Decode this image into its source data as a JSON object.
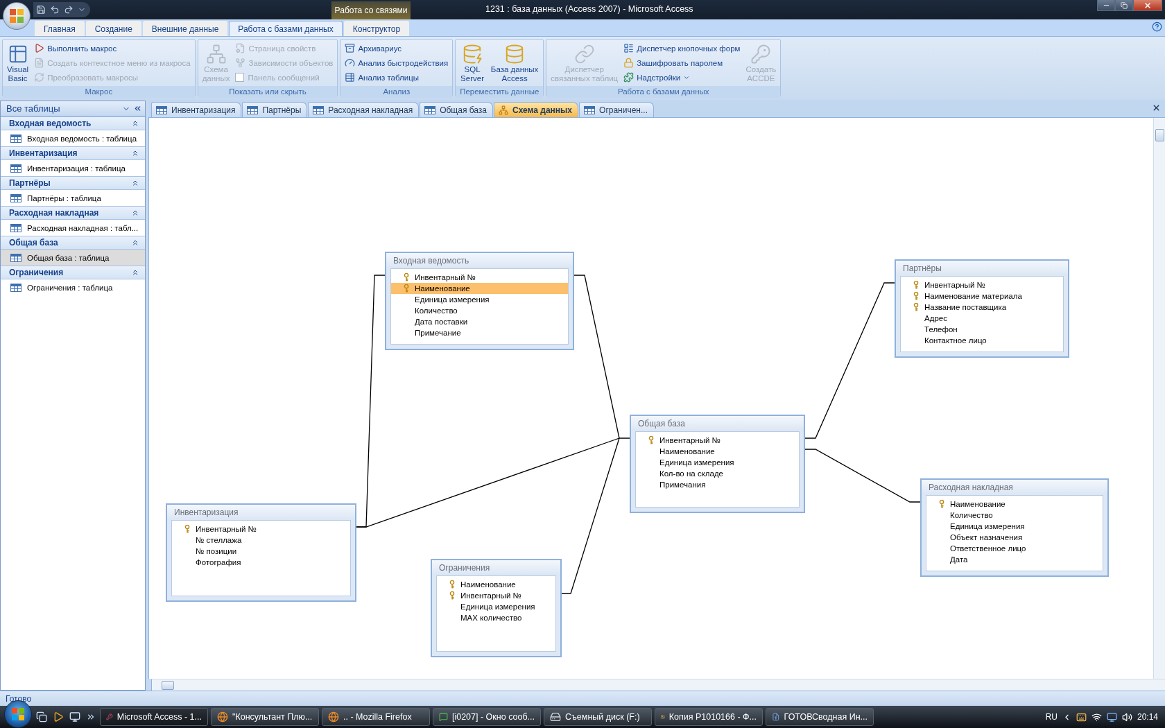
{
  "window": {
    "title": "1231 : база данных (Access 2007) - Microsoft Access",
    "context_tab": "Работа со связями"
  },
  "ribbon": {
    "tabs": [
      {
        "label": "Главная",
        "selected": false
      },
      {
        "label": "Создание",
        "selected": false
      },
      {
        "label": "Внешние данные",
        "selected": false
      },
      {
        "label": "Работа с базами данных",
        "selected": true
      },
      {
        "label": "Конструктор",
        "selected": false
      }
    ],
    "groups": [
      {
        "label": "Макрос",
        "items": [
          {
            "kind": "large",
            "label": "Visual\nBasic",
            "disabled": false
          },
          {
            "kind": "small",
            "label": "Выполнить макрос",
            "disabled": false
          },
          {
            "kind": "small",
            "label": "Создать контекстное меню из макроса",
            "disabled": true
          },
          {
            "kind": "small",
            "label": "Преобразовать макросы",
            "disabled": true
          }
        ]
      },
      {
        "label": "Показать или скрыть",
        "items": [
          {
            "kind": "large",
            "label": "Схема\nданных",
            "disabled": true
          },
          {
            "kind": "small",
            "label": "Страница свойств",
            "disabled": true
          },
          {
            "kind": "small",
            "label": "Зависимости объектов",
            "disabled": true
          },
          {
            "kind": "checkbox",
            "label": "Панель сообщений",
            "disabled": true,
            "checked": false
          }
        ]
      },
      {
        "label": "Анализ",
        "items": [
          {
            "kind": "small",
            "label": "Архивариус",
            "disabled": false
          },
          {
            "kind": "small",
            "label": "Анализ быстродействия",
            "disabled": false
          },
          {
            "kind": "small",
            "label": "Анализ таблицы",
            "disabled": false
          }
        ]
      },
      {
        "label": "Переместить данные",
        "items": [
          {
            "kind": "large",
            "label": "SQL\nServer",
            "disabled": false
          },
          {
            "kind": "large",
            "label": "База данных\nAccess",
            "disabled": false
          }
        ]
      },
      {
        "label": "Работа с базами данных",
        "items": [
          {
            "kind": "large",
            "label": "Диспетчер\nсвязанных таблиц",
            "disabled": true
          },
          {
            "kind": "small",
            "label": "Диспетчер кнопочных форм",
            "disabled": false
          },
          {
            "kind": "small",
            "label": "Зашифровать паролем",
            "disabled": false
          },
          {
            "kind": "menu",
            "label": "Надстройки",
            "disabled": false
          },
          {
            "kind": "large",
            "label": "Создать\nACCDE",
            "disabled": true
          }
        ]
      }
    ]
  },
  "navigation": {
    "header": "Все таблицы",
    "groups": [
      {
        "title": "Входная ведомость",
        "items": [
          {
            "label": "Входная ведомость : таблица",
            "selected": false
          }
        ]
      },
      {
        "title": "Инвентаризация",
        "items": [
          {
            "label": "Инвентаризация : таблица",
            "selected": false
          }
        ]
      },
      {
        "title": "Партнёры",
        "items": [
          {
            "label": "Партнёры : таблица",
            "selected": false
          }
        ]
      },
      {
        "title": "Расходная накладная",
        "items": [
          {
            "label": "Расходная накладная : табл...",
            "selected": false
          }
        ]
      },
      {
        "title": "Общая база",
        "items": [
          {
            "label": "Общая база : таблица",
            "selected": true
          }
        ]
      },
      {
        "title": "Ограничения",
        "items": [
          {
            "label": "Ограничения : таблица",
            "selected": false
          }
        ]
      }
    ]
  },
  "document_tabs": [
    {
      "label": "Инвентаризация",
      "kind": "table",
      "selected": false
    },
    {
      "label": "Партнёры",
      "kind": "table",
      "selected": false
    },
    {
      "label": "Расходная накладная",
      "kind": "table",
      "selected": false
    },
    {
      "label": "Общая база",
      "kind": "table",
      "selected": false
    },
    {
      "label": "Схема данных",
      "kind": "diagram",
      "selected": true
    },
    {
      "label": "Ограничен...",
      "kind": "table",
      "selected": false
    }
  ],
  "diagram": {
    "tables": [
      {
        "title": "Входная ведомость",
        "fields": [
          {
            "name": "Инвентарный №",
            "key": true,
            "selected": false
          },
          {
            "name": "Наименование",
            "key": true,
            "selected": true
          },
          {
            "name": "Единица измерения",
            "key": false,
            "selected": false
          },
          {
            "name": "Количество",
            "key": false,
            "selected": false
          },
          {
            "name": "Дата поставки",
            "key": false,
            "selected": false
          },
          {
            "name": "Примечание",
            "key": false,
            "selected": false
          }
        ]
      },
      {
        "title": "Партнёры",
        "fields": [
          {
            "name": "Инвентарный №",
            "key": true,
            "selected": false
          },
          {
            "name": "Наименование материала",
            "key": true,
            "selected": false
          },
          {
            "name": "Название поставщика",
            "key": true,
            "selected": false
          },
          {
            "name": "Адрес",
            "key": false,
            "selected": false
          },
          {
            "name": "Телефон",
            "key": false,
            "selected": false
          },
          {
            "name": "Контактное лицо",
            "key": false,
            "selected": false
          }
        ]
      },
      {
        "title": "Инвентаризация",
        "fields": [
          {
            "name": "Инвентарный №",
            "key": true,
            "selected": false
          },
          {
            "name": "№ стеллажа",
            "key": false,
            "selected": false
          },
          {
            "name": "№ позиции",
            "key": false,
            "selected": false
          },
          {
            "name": "Фотография",
            "key": false,
            "selected": false
          }
        ]
      },
      {
        "title": "Общая база",
        "fields": [
          {
            "name": "Инвентарный №",
            "key": true,
            "selected": false
          },
          {
            "name": "Наименование",
            "key": false,
            "selected": false
          },
          {
            "name": "Единица измерения",
            "key": false,
            "selected": false
          },
          {
            "name": "Кол-во на складе",
            "key": false,
            "selected": false
          },
          {
            "name": "Примечания",
            "key": false,
            "selected": false
          }
        ]
      },
      {
        "title": "Ограничения",
        "fields": [
          {
            "name": "Наименование",
            "key": true,
            "selected": false
          },
          {
            "name": "Инвентарный №",
            "key": true,
            "selected": false
          },
          {
            "name": "Единица измерения",
            "key": false,
            "selected": false
          },
          {
            "name": "MAX количество",
            "key": false,
            "selected": false
          }
        ]
      },
      {
        "title": "Расходная накладная",
        "fields": [
          {
            "name": "Наименование",
            "key": true,
            "selected": false
          },
          {
            "name": "Количество",
            "key": false,
            "selected": false
          },
          {
            "name": "Единица измерения",
            "key": false,
            "selected": false
          },
          {
            "name": "Объект назначения",
            "key": false,
            "selected": false
          },
          {
            "name": "Ответственное лицо",
            "key": false,
            "selected": false
          },
          {
            "name": "Дата",
            "key": false,
            "selected": false
          }
        ]
      }
    ]
  },
  "status_bar": {
    "text": "Готово"
  },
  "taskbar": {
    "tasks": [
      {
        "label": "Microsoft Access - 1...",
        "kind": "access",
        "selected": true
      },
      {
        "label": "\"Консультант Плю...",
        "kind": "firefox",
        "selected": false
      },
      {
        "label": ".. - Mozilla Firefox",
        "kind": "firefox",
        "selected": false
      },
      {
        "label": "[i0207] - Окно сооб...",
        "kind": "chat",
        "selected": false
      },
      {
        "label": "Съемный диск (F:)",
        "kind": "drive",
        "selected": false
      },
      {
        "label": "Копия P1010166 - Ф...",
        "kind": "photo",
        "selected": false
      },
      {
        "label": "ГОТОВСводная Ин...",
        "kind": "word",
        "selected": false
      }
    ],
    "language": "RU",
    "clock": "20:14"
  }
}
